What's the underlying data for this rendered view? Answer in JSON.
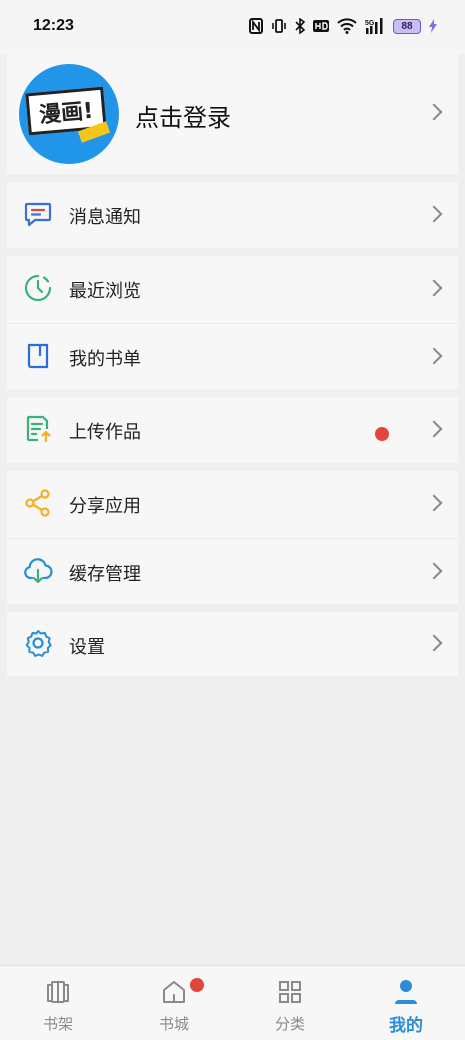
{
  "status_bar": {
    "time": "12:23",
    "battery": "88",
    "icons": [
      "nfc-icon",
      "vibrate-icon",
      "bluetooth-icon",
      "hd-icon",
      "wifi-icon",
      "signal-5g-icon",
      "battery-icon",
      "charging-icon"
    ]
  },
  "profile": {
    "avatar_text": "漫画!",
    "login_label": "点击登录"
  },
  "menu": {
    "messages": "消息通知",
    "history": "最近浏览",
    "booklist": "我的书单",
    "upload": "上传作品",
    "share": "分享应用",
    "cache": "缓存管理",
    "settings": "设置"
  },
  "tabs": [
    {
      "label": "书架",
      "icon": "bookshelf-icon"
    },
    {
      "label": "书城",
      "icon": "home-icon"
    },
    {
      "label": "分类",
      "icon": "category-icon"
    },
    {
      "label": "我的",
      "icon": "person-icon"
    }
  ],
  "colors": {
    "accent": "#2a8ed6",
    "badge": "#e0463a",
    "messages_icon": "#3a6fd8",
    "history_icon": "#3ab07a",
    "upload_icon": "#3ab07a",
    "share_icon": "#f0b020",
    "cache_icon": "#2a8ed6",
    "settings_icon": "#2a8ed6"
  }
}
